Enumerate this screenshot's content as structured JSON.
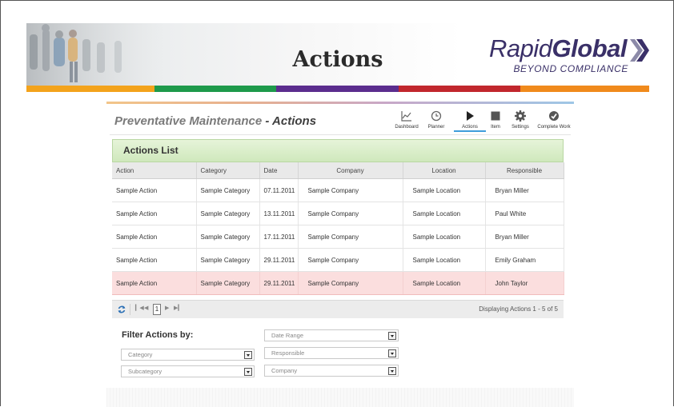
{
  "banner": {
    "title": "Actions",
    "logo_part1": "Rapid",
    "logo_part2": "Global",
    "tagline": "BEYOND COMPLIANCE",
    "stripe_colors": [
      "#f3a31c",
      "#1e9a4b",
      "#5b2d8e",
      "#c1272d",
      "#f08a1c"
    ]
  },
  "app": {
    "title_prefix": "Preventative Maintenance",
    "title_sep": " - ",
    "title_highlight": "Actions",
    "toolbar": [
      {
        "label": "Dashboard",
        "icon": "chart-icon"
      },
      {
        "label": "Planner",
        "icon": "clock-icon"
      },
      {
        "label": "Actions",
        "icon": "play-icon",
        "active": true
      },
      {
        "label": "Item",
        "icon": "square-icon"
      },
      {
        "label": "Settings",
        "icon": "gear-icon"
      },
      {
        "label": "Complete Work",
        "icon": "check-icon"
      }
    ]
  },
  "grid": {
    "title": "Actions List",
    "columns": [
      "Action",
      "Category",
      "Date",
      "Company",
      "Location",
      "Responsible"
    ],
    "rows": [
      [
        "Sample Action",
        "Sample Category",
        "07.11.2011",
        "Sample Company",
        "Sample Location",
        "Bryan Miller"
      ],
      [
        "Sample Action",
        "Sample Category",
        "13.11.2011",
        "Sample Company",
        "Sample Location",
        "Paul White"
      ],
      [
        "Sample Action",
        "Sample Category",
        "17.11.2011",
        "Sample Company",
        "Sample Location",
        "Bryan Miller"
      ],
      [
        "Sample Action",
        "Sample Category",
        "29.11.2011",
        "Sample Company",
        "Sample Location",
        "Emily Graham"
      ],
      [
        "Sample Action",
        "Sample Category",
        "29.11.2011",
        "Sample Company",
        "Sample Location",
        "John Taylor"
      ]
    ],
    "selected_row": 4
  },
  "pager": {
    "page": "1",
    "display_text": "Displaying Actions 1 - 5 of 5"
  },
  "filters": {
    "title": "Filter Actions by:",
    "category": "Category",
    "subcategory": "Subcategory",
    "date_range": "Date Range",
    "responsible": "Responsible",
    "company": "Company"
  }
}
